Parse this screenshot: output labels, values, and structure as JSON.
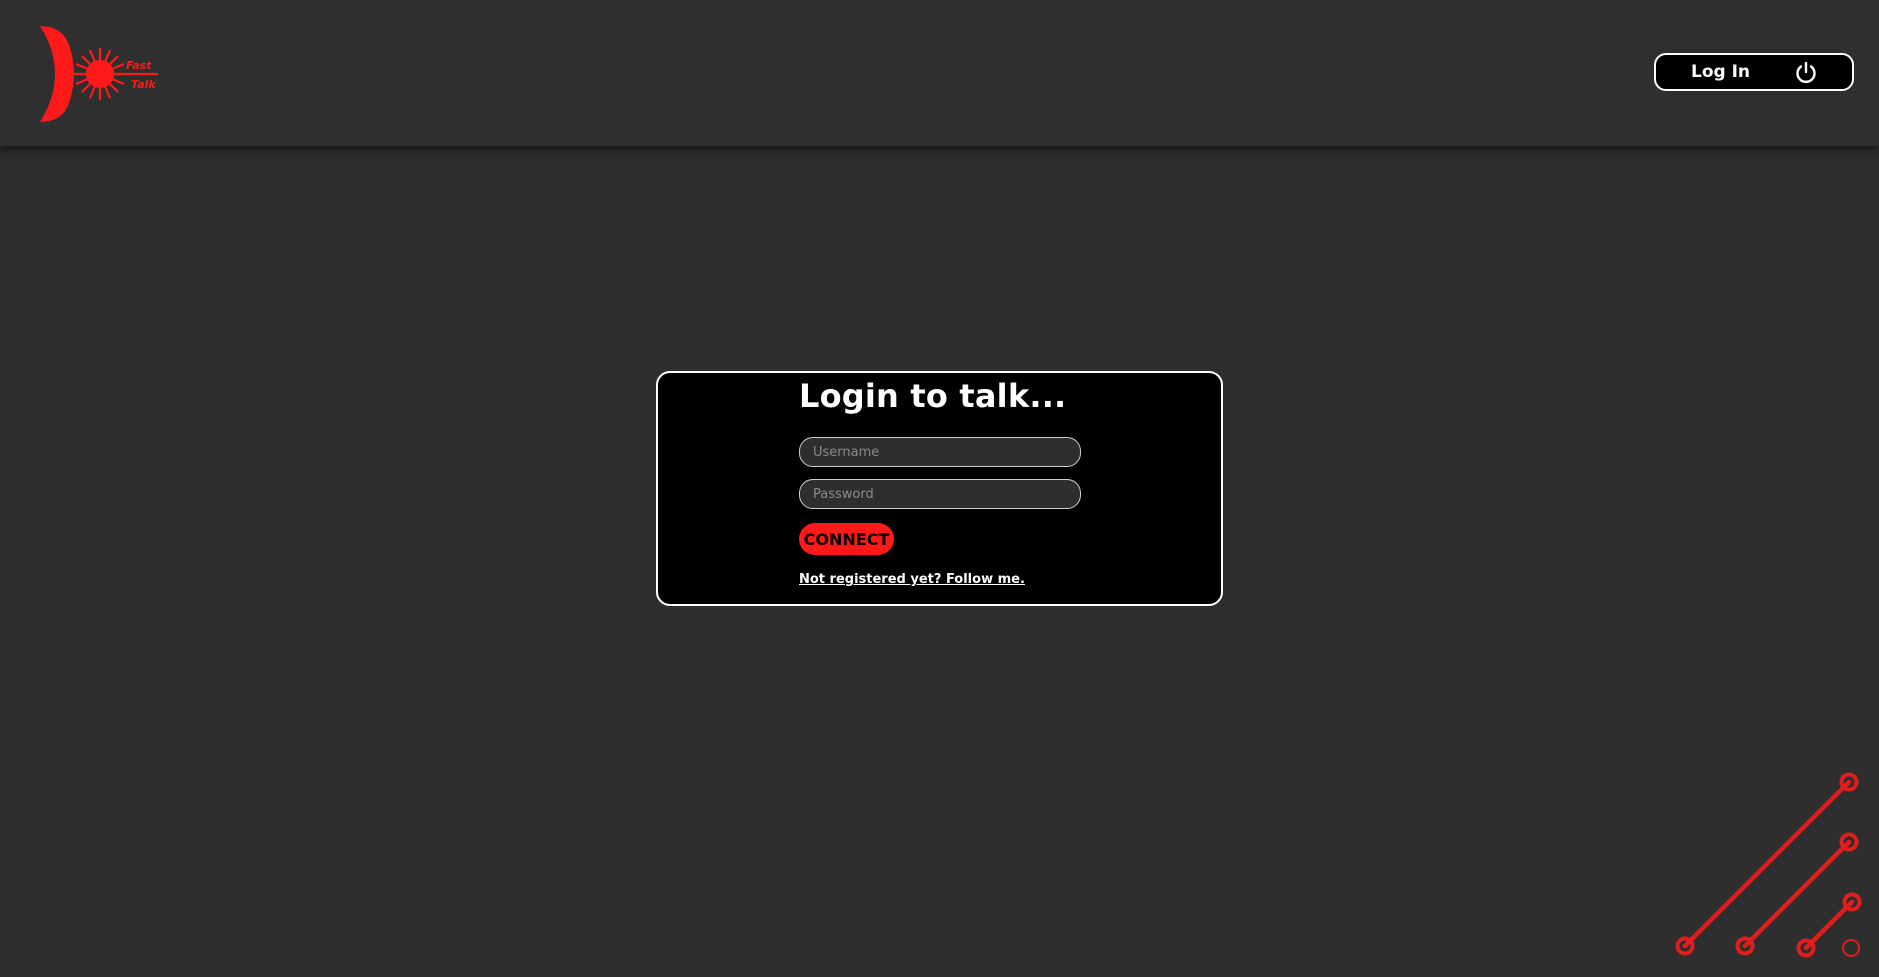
{
  "header": {
    "logo": {
      "icon": "fast-talk-logo",
      "text_line1": "Fast",
      "text_line2": "Talk",
      "color": "#ff1a1a"
    },
    "login_button": {
      "label": "Log In",
      "icon": "power-icon"
    }
  },
  "login_card": {
    "title": "Login to talk...",
    "username": {
      "placeholder": "Username",
      "value": ""
    },
    "password": {
      "placeholder": "Password",
      "value": ""
    },
    "connect_label": "CONNECT",
    "register_link": "Not registered yet? Follow me."
  },
  "decoration": {
    "icon": "circuit-lines-decoration",
    "color": "#e01e1e"
  },
  "colors": {
    "background": "#2e2e2e",
    "accent": "#ff1a1a",
    "card": "#000000"
  }
}
